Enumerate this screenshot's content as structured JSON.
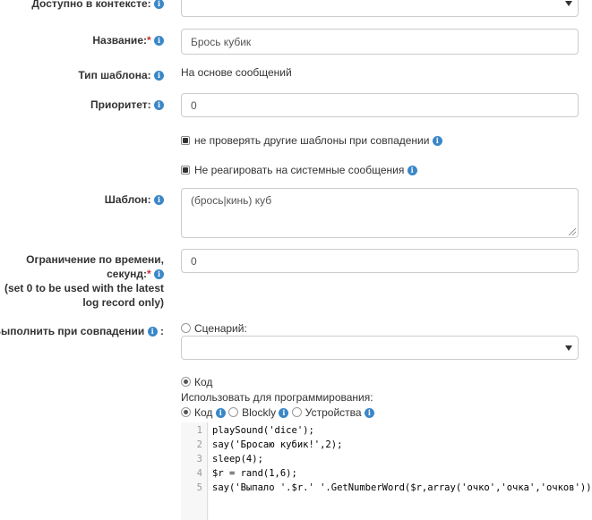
{
  "context": {
    "label": "Доступно в контексте:",
    "value": ""
  },
  "name": {
    "label": "Название:",
    "required_mark": "*",
    "value": "Брось кубик"
  },
  "template_type": {
    "label": "Тип шаблона:",
    "value": "На основе сообщений"
  },
  "priority": {
    "label": "Приоритет:",
    "value": "0"
  },
  "checkboxes": [
    {
      "label": "не проверять другие шаблоны при совпадении",
      "checked": true
    },
    {
      "label": "Не реагировать на системные сообщения",
      "checked": true
    }
  ],
  "template": {
    "label": "Шаблон:",
    "value": "(брось|кинь) куб"
  },
  "time_limit": {
    "label_line1": "Ограничение по времени,",
    "label_line2": "секунд:",
    "required_mark": "*",
    "hint_line1": "(set 0 to be used with the latest",
    "hint_line2": "log record only)",
    "value": "0"
  },
  "on_match": {
    "label": "Выполнить при совпадении",
    "label_suffix": ":",
    "scenario_option": "Сценарий:",
    "scenario_selected": false,
    "scenario_value": "",
    "code_option": "Код",
    "code_selected": true,
    "use_for_programming": "Использовать для программирования:",
    "modes": [
      {
        "label": "Код",
        "selected": true
      },
      {
        "label": "Blockly",
        "selected": false
      },
      {
        "label": "Устройства",
        "selected": false
      }
    ]
  },
  "code": {
    "line_numbers": [
      "1",
      "2",
      "3",
      "4",
      "5"
    ],
    "lines": [
      "playSound('dice');",
      "say('Бросаю кубик!',2);",
      "sleep(4);",
      "$r = rand(1,6);",
      "say('Выпало '.$r.' '.GetNumberWord($r,array('очко','очка','очков'));"
    ]
  },
  "icons": {
    "info": "info-icon",
    "dropdown": "chevron-down-icon"
  },
  "colors": {
    "info_icon": "#3a87c8",
    "required": "#c9302c"
  }
}
